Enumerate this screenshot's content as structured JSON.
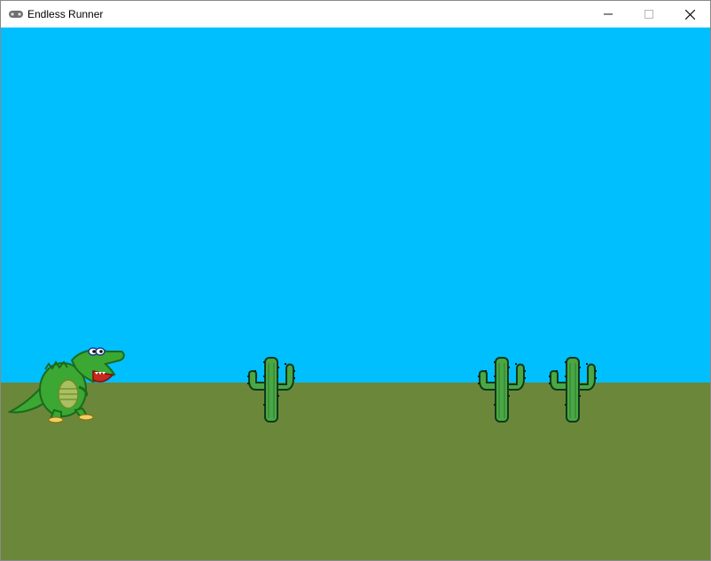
{
  "window": {
    "title": "Endless Runner",
    "icon": "gamepad-icon"
  },
  "game": {
    "colors": {
      "sky": "#00bfff",
      "ground": "#6b873a",
      "dino_body": "#3aa832",
      "cactus": "#4aa844"
    },
    "player": {
      "sprite": "dinosaur"
    },
    "obstacles": [
      {
        "sprite": "cactus"
      },
      {
        "sprite": "cactus"
      },
      {
        "sprite": "cactus"
      }
    ]
  }
}
